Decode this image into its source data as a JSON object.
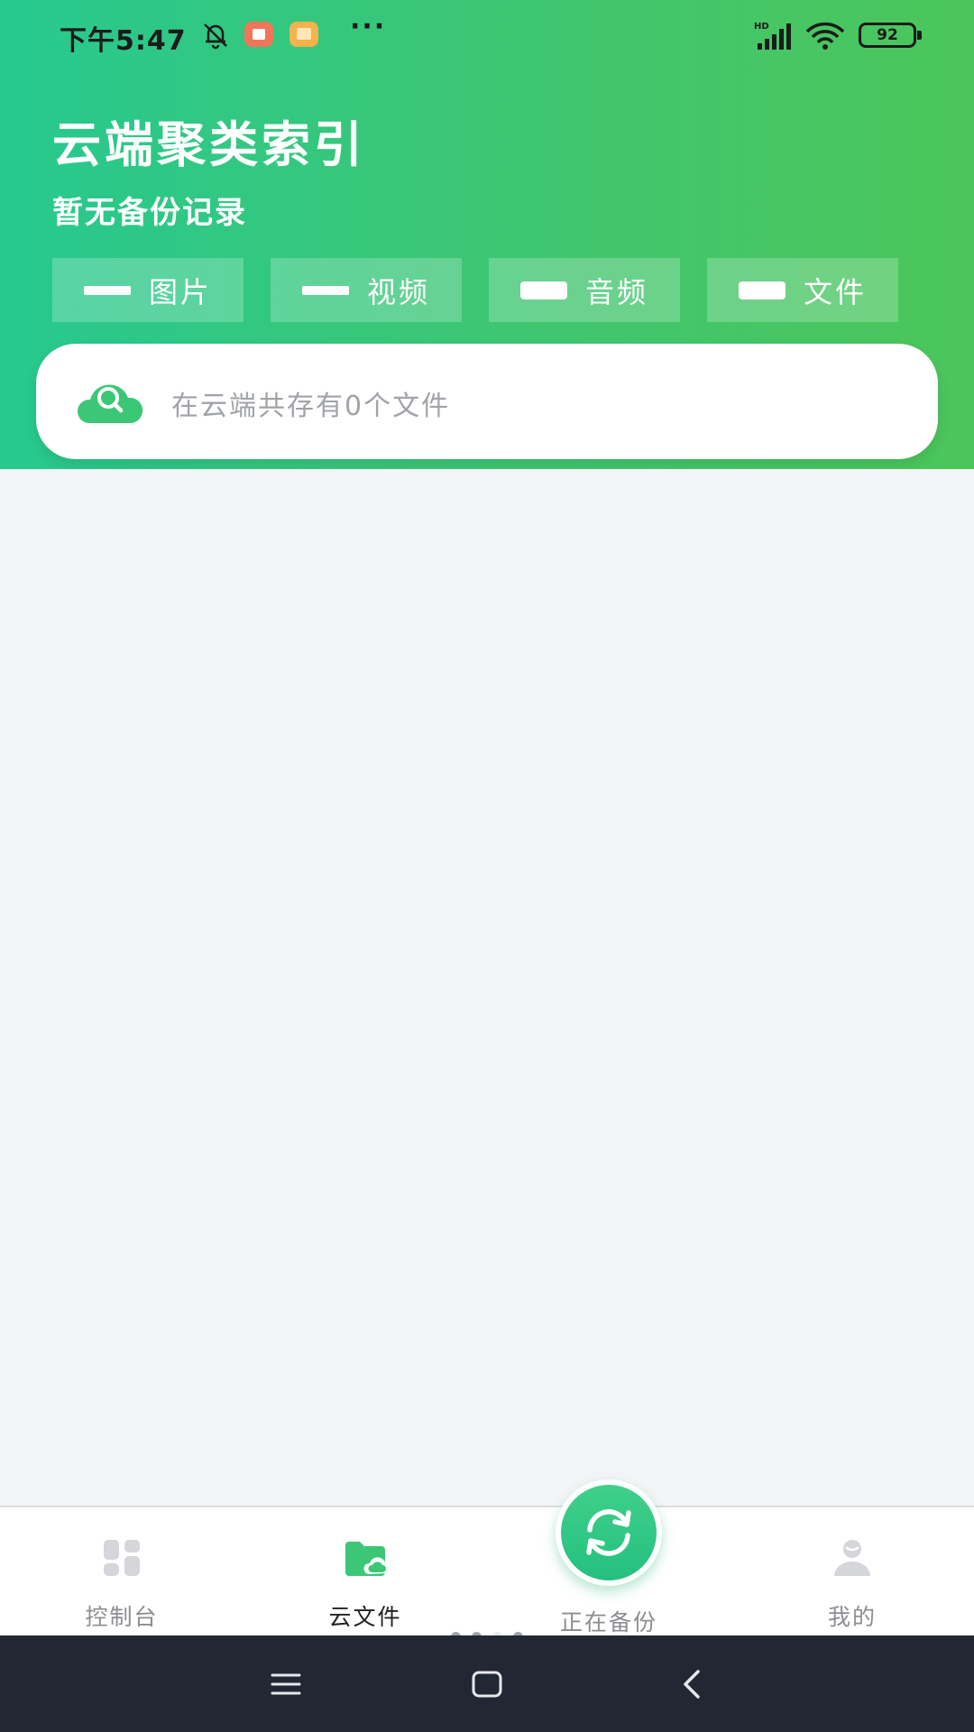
{
  "status_bar": {
    "time": "下午5:47",
    "battery": "92",
    "icons": [
      "bell-muted-icon",
      "app-notification-icon",
      "gallery-notification-icon",
      "more-dots-icon",
      "hd-signal-icon",
      "wifi-icon",
      "battery-icon"
    ]
  },
  "header": {
    "title": "云端聚类索引",
    "subtitle": "暂无备份记录"
  },
  "categories": [
    {
      "label": "图片"
    },
    {
      "label": "视频"
    },
    {
      "label": "音频"
    },
    {
      "label": "文件"
    }
  ],
  "search": {
    "placeholder": "在云端共存有0个文件"
  },
  "tabs": [
    {
      "label": "控制台",
      "icon": "dashboard-icon"
    },
    {
      "label": "云文件",
      "icon": "cloud-folder-icon",
      "active": true
    },
    {
      "label": "正在备份",
      "icon": "sync-icon"
    },
    {
      "label": "我的",
      "icon": "profile-icon"
    }
  ],
  "colors": {
    "accent": "#3fc671",
    "header_start": "#27c98f",
    "header_end": "#4cc65a",
    "nav_bar": "#222833"
  }
}
